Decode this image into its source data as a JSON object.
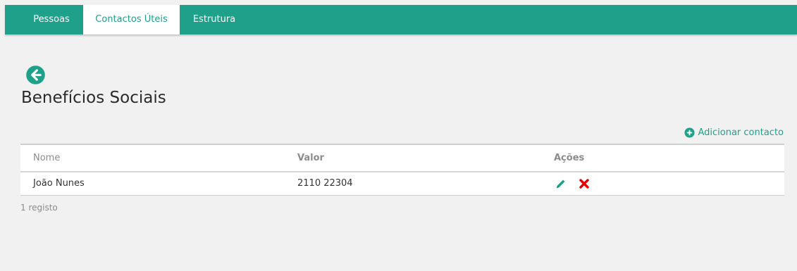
{
  "nav": {
    "tabs": [
      {
        "label": "Pessoas",
        "active": false
      },
      {
        "label": "Contactos Úteis",
        "active": true
      },
      {
        "label": "Estrutura",
        "active": false
      }
    ]
  },
  "page": {
    "title": "Benefícios Sociais",
    "back_icon": "arrow-circle-left-icon"
  },
  "actions": {
    "add_contact_label": "Adicionar contacto",
    "add_icon": "plus-circle-icon"
  },
  "table": {
    "headers": [
      "Nome",
      "Valor",
      "Ações"
    ],
    "rows": [
      {
        "nome": "João Nunes",
        "valor": "2110 22304",
        "actions": [
          "pencil-icon",
          "close-icon"
        ]
      }
    ]
  },
  "footer": {
    "count_text": "1 registo"
  },
  "colors": {
    "accent": "#1fa08a",
    "delete": "#e60000",
    "background": "#f1f1f1"
  }
}
